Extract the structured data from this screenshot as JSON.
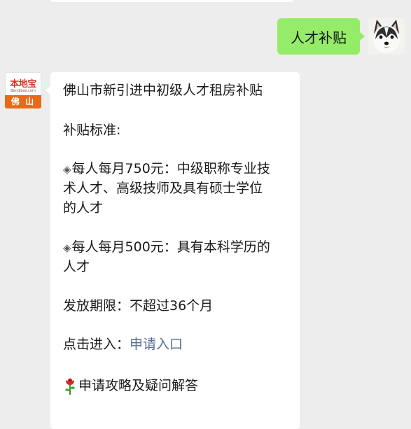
{
  "outgoing": {
    "text": "人才补贴"
  },
  "bot": {
    "logo_text": "本地宝",
    "domain_text": "Bendibao.com",
    "city_label": "佛 山"
  },
  "card": {
    "title": "佛山市新引进中初级人才租房补贴",
    "standard_label": "补贴标准:",
    "bullet_glyph": "◈",
    "item1": {
      "line1": "每人每月750元：中级职称专业技",
      "line2": "术人才、高级技师及具有硕士学位",
      "line3": "的人才"
    },
    "item2": {
      "line1": "每人每月500元：具有本科学历的",
      "line2": "人才"
    },
    "period": "发放期限：不超过36个月",
    "entry_prefix": "点击进入：",
    "entry_link": "申请入口",
    "guide_link": "申请攻略及疑问解答"
  },
  "colors": {
    "outgoing_bubble": "#95ec69",
    "background": "#ededed",
    "link": "#576b95",
    "city_badge": "#e86a16",
    "logo_red": "#d4382a"
  },
  "icons": {
    "user_avatar": "husky-dog-avatar",
    "guide_prefix": "rose-icon",
    "bullet": "diamond-bullet-icon"
  }
}
